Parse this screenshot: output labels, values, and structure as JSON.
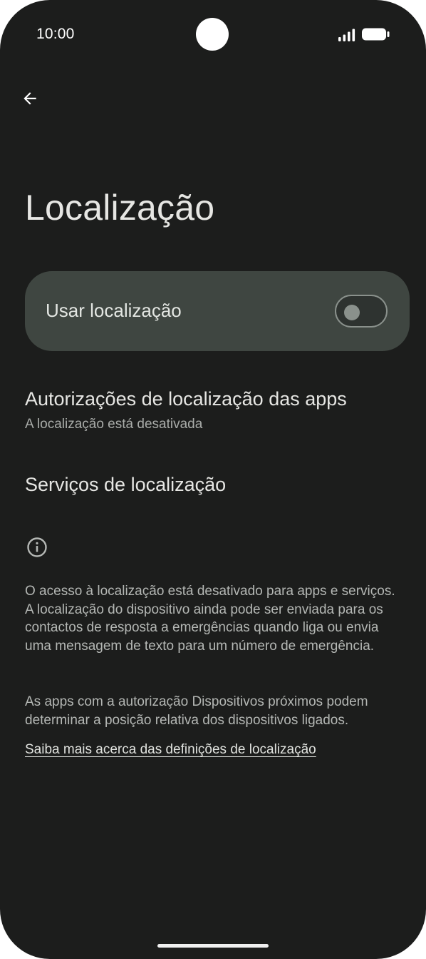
{
  "status_bar": {
    "time": "10:00"
  },
  "header": {
    "back_icon": "arrow-back-icon",
    "title": "Localização"
  },
  "location_toggle": {
    "label": "Usar localização",
    "state": "off"
  },
  "items": [
    {
      "title": "Autorizações de localização das apps",
      "subtitle": "A localização está desativada"
    },
    {
      "title": "Serviços de localização"
    }
  ],
  "footer": {
    "info_icon": "info-icon",
    "paragraph_1": "O acesso à localização está desativado para apps e serviços. A localização do dispositivo ainda pode ser enviada para os contactos de resposta a emergências quando liga ou envia uma mensagem de texto para um número de emergência.",
    "paragraph_2": "As apps com a autorização Dispositivos próximos podem determinar a posição relativa dos dispositivos ligados.",
    "link": "Saiba mais acerca das definições de localização"
  },
  "colors": {
    "background": "#1c1d1c",
    "card": "#3f4641",
    "text_primary": "#e6e6e3",
    "text_secondary": "#a9aca9"
  }
}
